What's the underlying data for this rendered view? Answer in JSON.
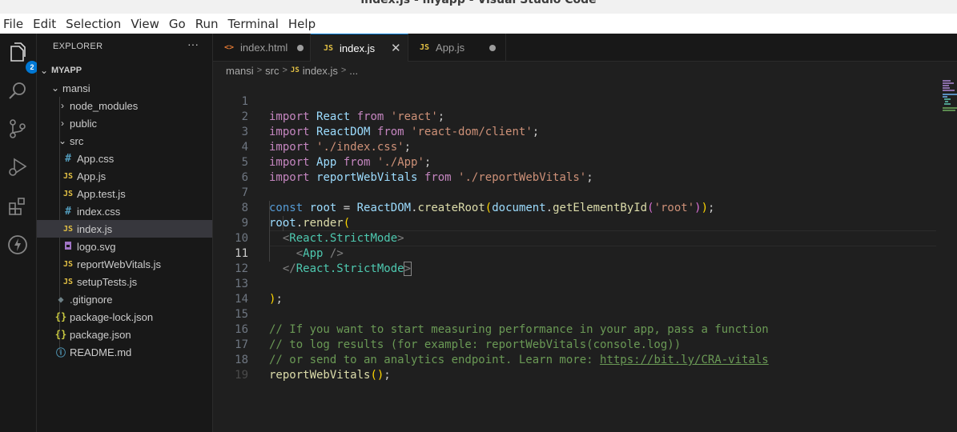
{
  "window": {
    "title": "index.js - myapp - Visual Studio Code"
  },
  "menu": [
    "File",
    "Edit",
    "Selection",
    "View",
    "Go",
    "Run",
    "Terminal",
    "Help"
  ],
  "activity": {
    "explorer_badge": "2"
  },
  "sidebar": {
    "title": "EXPLORER",
    "more": "···",
    "root": "MYAPP",
    "items": [
      {
        "label": "mansi",
        "kind": "folder-open"
      },
      {
        "label": "node_modules",
        "kind": "folder"
      },
      {
        "label": "public",
        "kind": "folder"
      },
      {
        "label": "src",
        "kind": "folder-open"
      },
      {
        "label": "App.css",
        "kind": "css"
      },
      {
        "label": "App.js",
        "kind": "js"
      },
      {
        "label": "App.test.js",
        "kind": "js"
      },
      {
        "label": "index.css",
        "kind": "css"
      },
      {
        "label": "index.js",
        "kind": "js",
        "selected": true
      },
      {
        "label": "logo.svg",
        "kind": "svg"
      },
      {
        "label": "reportWebVitals.js",
        "kind": "js"
      },
      {
        "label": "setupTests.js",
        "kind": "js"
      },
      {
        "label": ".gitignore",
        "kind": "git"
      },
      {
        "label": "package-lock.json",
        "kind": "json"
      },
      {
        "label": "package.json",
        "kind": "json"
      },
      {
        "label": "README.md",
        "kind": "info"
      }
    ]
  },
  "tabs": [
    {
      "label": "index.html",
      "modified": true
    },
    {
      "label": "index.js",
      "active": true
    },
    {
      "label": "App.js",
      "modified": true
    }
  ],
  "breadcrumb": {
    "parts": [
      "mansi",
      "src",
      "index.js",
      "..."
    ]
  },
  "editor": {
    "current_line": "11",
    "line_numbers": [
      "1",
      "2",
      "3",
      "4",
      "5",
      "6",
      "7",
      "8",
      "9",
      "10",
      "11",
      "12",
      "13",
      "14",
      "15",
      "16",
      "17",
      "18",
      "19"
    ],
    "tokens": {
      "import": "import",
      "from": "from",
      "const": "const",
      "React": "React",
      "ReactDOM": "ReactDOM",
      "App": "App",
      "reportWebVitals": "reportWebVitals",
      "s_react": "'react'",
      "s_client": "'react-dom/client'",
      "s_css": "'./index.css'",
      "s_app": "'./App'",
      "s_rwv": "'./reportWebVitals'",
      "root": "root",
      "createRoot": "createRoot",
      "document": "document",
      "getElementById": "getElementById",
      "s_root": "'root'",
      "render": "render",
      "strictmode": "React.StrictMode",
      "c1": "// If you want to start measuring performance in your app, pass a function",
      "c2": "// to log results (for example: reportWebVitals(console.log))",
      "c3": "// or send to an analytics endpoint. Learn more: ",
      "c3_url": "https://bit.ly/CRA-vitals"
    }
  },
  "colors": {
    "accent": "#0078d4",
    "background": "#1f1f1f",
    "sidebar": "#181818"
  }
}
